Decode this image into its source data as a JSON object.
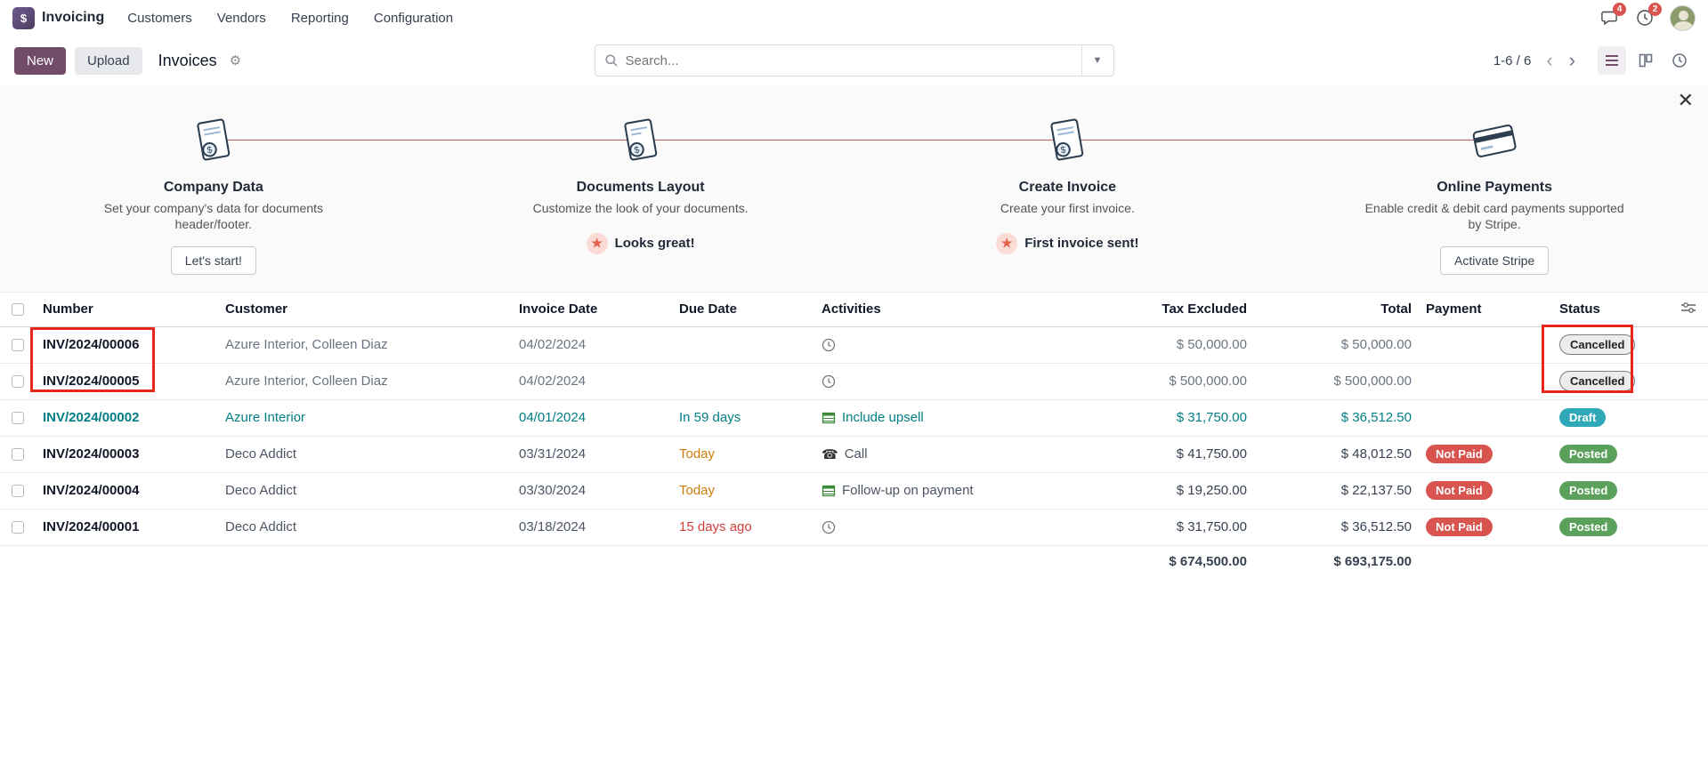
{
  "colors": {
    "brand_primary": "#714B67",
    "teal_accent": "#017E84",
    "status_draft": "#2FA9B8",
    "status_posted": "#5BA05B",
    "status_cancelled_bg": "#ECECEC",
    "payment_not_paid": "#D9534F",
    "annotation_red": "#E8251A",
    "due_warning_orange": "#CE7A06",
    "due_danger_red": "#D23F3A"
  },
  "navbar": {
    "app_name": "Invoicing",
    "menus": [
      {
        "label": "Customers"
      },
      {
        "label": "Vendors"
      },
      {
        "label": "Reporting"
      },
      {
        "label": "Configuration"
      }
    ],
    "messages_badge": "4",
    "activities_badge": "2"
  },
  "control_panel": {
    "new_button": "New",
    "upload_button": "Upload",
    "breadcrumb_title": "Invoices",
    "search_placeholder": "Search...",
    "pager_text": "1-6 / 6"
  },
  "onboarding": {
    "steps": [
      {
        "title": "Company Data",
        "description": "Set your company's data for documents header/footer.",
        "action_label": "Let's start!"
      },
      {
        "title": "Documents Layout",
        "description": "Customize the look of your documents.",
        "done_label": "Looks great!"
      },
      {
        "title": "Create Invoice",
        "description": "Create your first invoice.",
        "done_label": "First invoice sent!"
      },
      {
        "title": "Online Payments",
        "description": "Enable credit & debit card payments supported by Stripe.",
        "action_label": "Activate Stripe"
      }
    ]
  },
  "table": {
    "headers": {
      "number": "Number",
      "customer": "Customer",
      "invoice_date": "Invoice Date",
      "due_date": "Due Date",
      "activities": "Activities",
      "tax_excluded": "Tax Excluded",
      "total": "Total",
      "payment": "Payment",
      "status": "Status"
    },
    "rows": [
      {
        "number": "INV/2024/00006",
        "customer": "Azure Interior, Colleen Diaz",
        "invoice_date": "04/02/2024",
        "due_date": "",
        "activity_label": "",
        "tax_excluded": "$ 50,000.00",
        "total": "$ 50,000.00",
        "payment": "",
        "status": "Cancelled"
      },
      {
        "number": "INV/2024/00005",
        "customer": "Azure Interior, Colleen Diaz",
        "invoice_date": "04/02/2024",
        "due_date": "",
        "activity_label": "",
        "tax_excluded": "$ 500,000.00",
        "total": "$ 500,000.00",
        "payment": "",
        "status": "Cancelled"
      },
      {
        "number": "INV/2024/00002",
        "customer": "Azure Interior",
        "invoice_date": "04/01/2024",
        "due_date": "In 59 days",
        "activity_label": "Include upsell",
        "tax_excluded": "$ 31,750.00",
        "total": "$ 36,512.50",
        "payment": "",
        "status": "Draft"
      },
      {
        "number": "INV/2024/00003",
        "customer": "Deco Addict",
        "invoice_date": "03/31/2024",
        "due_date": "Today",
        "activity_label": "Call",
        "tax_excluded": "$ 41,750.00",
        "total": "$ 48,012.50",
        "payment": "Not Paid",
        "status": "Posted"
      },
      {
        "number": "INV/2024/00004",
        "customer": "Deco Addict",
        "invoice_date": "03/30/2024",
        "due_date": "Today",
        "activity_label": "Follow-up on payment",
        "tax_excluded": "$ 19,250.00",
        "total": "$ 22,137.50",
        "payment": "Not Paid",
        "status": "Posted"
      },
      {
        "number": "INV/2024/00001",
        "customer": "Deco Addict",
        "invoice_date": "03/18/2024",
        "due_date": "15 days ago",
        "activity_label": "",
        "tax_excluded": "$ 31,750.00",
        "total": "$ 36,512.50",
        "payment": "Not Paid",
        "status": "Posted"
      }
    ],
    "totals": {
      "tax_excluded": "$ 674,500.00",
      "total": "$ 693,175.00"
    }
  }
}
